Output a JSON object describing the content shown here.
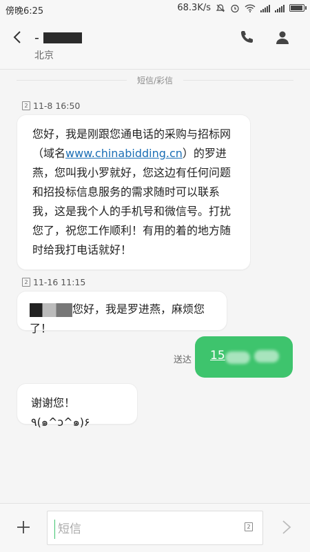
{
  "status_bar": {
    "time": "傍晚6:25",
    "net_speed": "68.3K/s"
  },
  "header": {
    "contact_suffix": "-",
    "location": "北京"
  },
  "thread": {
    "channel_label": "短信/彩信",
    "messages": [
      {
        "sim": "2",
        "timestamp": "11-8 16:50",
        "text_pre": "您好，我是刚跟您通电话的采购与招标网（域名",
        "link": "www.chinabidding.cn",
        "text_post": "）的罗进燕，您叫我小罗就好，您这边有任何问题和招投标信息服务的需求随时可以联系我，这是我个人的手机号和微信号。打扰您了，祝您工作顺利！有用的着的地方随时给我打电话就好！"
      },
      {
        "sim": "2",
        "timestamp": "11-16 11:15",
        "text": "您好，我是罗进燕，麻烦您了！"
      },
      {
        "status": "送达",
        "text": "15"
      },
      {
        "text": "谢谢您！٩(๑^ↄ^๑)۶"
      }
    ]
  },
  "composer": {
    "placeholder": "短信",
    "sim_label": "2"
  },
  "colors": {
    "accent_green": "#3ec46d",
    "link_blue": "#1a6eb5"
  }
}
